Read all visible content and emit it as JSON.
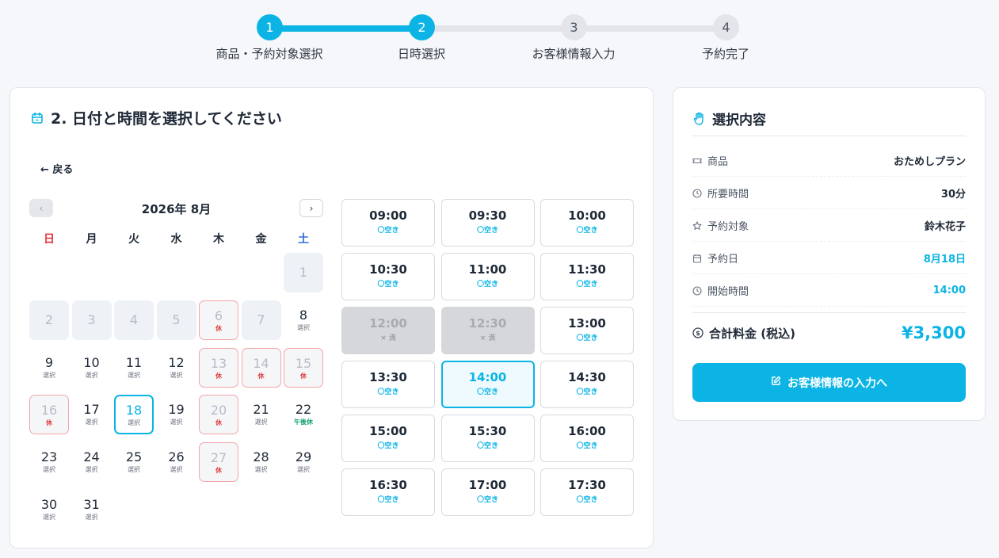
{
  "colors": {
    "accent": "#0bb4e4",
    "holiday": "#e0363c",
    "saturday": "#2f6fd6",
    "half_day": "#0d9e6e"
  },
  "stepper": [
    {
      "num": "1",
      "label": "商品・予約対象選択",
      "state": "done"
    },
    {
      "num": "2",
      "label": "日時選択",
      "state": "active"
    },
    {
      "num": "3",
      "label": "お客様情報入力",
      "state": "todo"
    },
    {
      "num": "4",
      "label": "予約完了",
      "state": "todo"
    }
  ],
  "main": {
    "title": "2. 日付と時間を選択してください",
    "title_icon": "calendar-icon",
    "back_label": "← 戻る"
  },
  "calendar": {
    "month_label": "2026年 8月",
    "prev_icon": "chevron-left-icon",
    "next_icon": "chevron-right-icon",
    "weekdays": [
      "日",
      "月",
      "火",
      "水",
      "木",
      "金",
      "土"
    ],
    "leading_blanks": 6,
    "days": [
      {
        "d": "1",
        "state": "past",
        "sub": ""
      },
      {
        "d": "2",
        "state": "past",
        "sub": ""
      },
      {
        "d": "3",
        "state": "past",
        "sub": ""
      },
      {
        "d": "4",
        "state": "past",
        "sub": ""
      },
      {
        "d": "5",
        "state": "past",
        "sub": ""
      },
      {
        "d": "6",
        "state": "holiday",
        "sub": "休"
      },
      {
        "d": "7",
        "state": "past",
        "sub": ""
      },
      {
        "d": "8",
        "state": "open",
        "sub": "選択"
      },
      {
        "d": "9",
        "state": "open",
        "sub": "選択"
      },
      {
        "d": "10",
        "state": "open",
        "sub": "選択"
      },
      {
        "d": "11",
        "state": "open",
        "sub": "選択"
      },
      {
        "d": "12",
        "state": "open",
        "sub": "選択"
      },
      {
        "d": "13",
        "state": "holiday",
        "sub": "休"
      },
      {
        "d": "14",
        "state": "holiday",
        "sub": "休"
      },
      {
        "d": "15",
        "state": "holiday",
        "sub": "休"
      },
      {
        "d": "16",
        "state": "holiday",
        "sub": "休"
      },
      {
        "d": "17",
        "state": "open",
        "sub": "選択"
      },
      {
        "d": "18",
        "state": "selected",
        "sub": "選択"
      },
      {
        "d": "19",
        "state": "open",
        "sub": "選択"
      },
      {
        "d": "20",
        "state": "holiday",
        "sub": "休"
      },
      {
        "d": "21",
        "state": "open",
        "sub": "選択"
      },
      {
        "d": "22",
        "state": "halfday",
        "sub": "午後休"
      },
      {
        "d": "23",
        "state": "open",
        "sub": "選択"
      },
      {
        "d": "24",
        "state": "open",
        "sub": "選択"
      },
      {
        "d": "25",
        "state": "open",
        "sub": "選択"
      },
      {
        "d": "26",
        "state": "open",
        "sub": "選択"
      },
      {
        "d": "27",
        "state": "holiday",
        "sub": "休"
      },
      {
        "d": "28",
        "state": "open",
        "sub": "選択"
      },
      {
        "d": "29",
        "state": "open",
        "sub": "選択"
      },
      {
        "d": "30",
        "state": "open",
        "sub": "選択"
      },
      {
        "d": "31",
        "state": "open",
        "sub": "選択"
      }
    ]
  },
  "slots": [
    {
      "time": "09:00",
      "status": "〇空き",
      "state": "open"
    },
    {
      "time": "09:30",
      "status": "〇空き",
      "state": "open"
    },
    {
      "time": "10:00",
      "status": "〇空き",
      "state": "open"
    },
    {
      "time": "10:30",
      "status": "〇空き",
      "state": "open"
    },
    {
      "time": "11:00",
      "status": "〇空き",
      "state": "open"
    },
    {
      "time": "11:30",
      "status": "〇空き",
      "state": "open"
    },
    {
      "time": "12:00",
      "status": "× 満",
      "state": "full"
    },
    {
      "time": "12:30",
      "status": "× 満",
      "state": "full"
    },
    {
      "time": "13:00",
      "status": "〇空き",
      "state": "open"
    },
    {
      "time": "13:30",
      "status": "〇空き",
      "state": "open"
    },
    {
      "time": "14:00",
      "status": "〇空き",
      "state": "selected"
    },
    {
      "time": "14:30",
      "status": "〇空き",
      "state": "open"
    },
    {
      "time": "15:00",
      "status": "〇空き",
      "state": "open"
    },
    {
      "time": "15:30",
      "status": "〇空き",
      "state": "open"
    },
    {
      "time": "16:00",
      "status": "〇空き",
      "state": "open"
    },
    {
      "time": "16:30",
      "status": "〇空き",
      "state": "open"
    },
    {
      "time": "17:00",
      "status": "〇空き",
      "state": "open"
    },
    {
      "time": "17:30",
      "status": "〇空き",
      "state": "open"
    }
  ],
  "summary": {
    "title": "選択内容",
    "title_icon": "hand-icon",
    "rows": [
      {
        "label": "商品",
        "value": "おためしプラン",
        "icon": "ticket-icon",
        "accent": false
      },
      {
        "label": "所要時間",
        "value": "30分",
        "icon": "clock-icon",
        "accent": false
      },
      {
        "label": "予約対象",
        "value": "鈴木花子",
        "icon": "star-icon",
        "accent": false
      },
      {
        "label": "予約日",
        "value": "8月18日",
        "icon": "calendar-icon",
        "accent": true
      },
      {
        "label": "開始時間",
        "value": "14:00",
        "icon": "clock-icon",
        "accent": true
      }
    ],
    "total_label": "合計料金 (税込)",
    "total_icon": "dollar-circle-icon",
    "total_value": "¥3,300",
    "cta_label": "お客様情報の入力へ",
    "cta_icon": "edit-icon"
  }
}
